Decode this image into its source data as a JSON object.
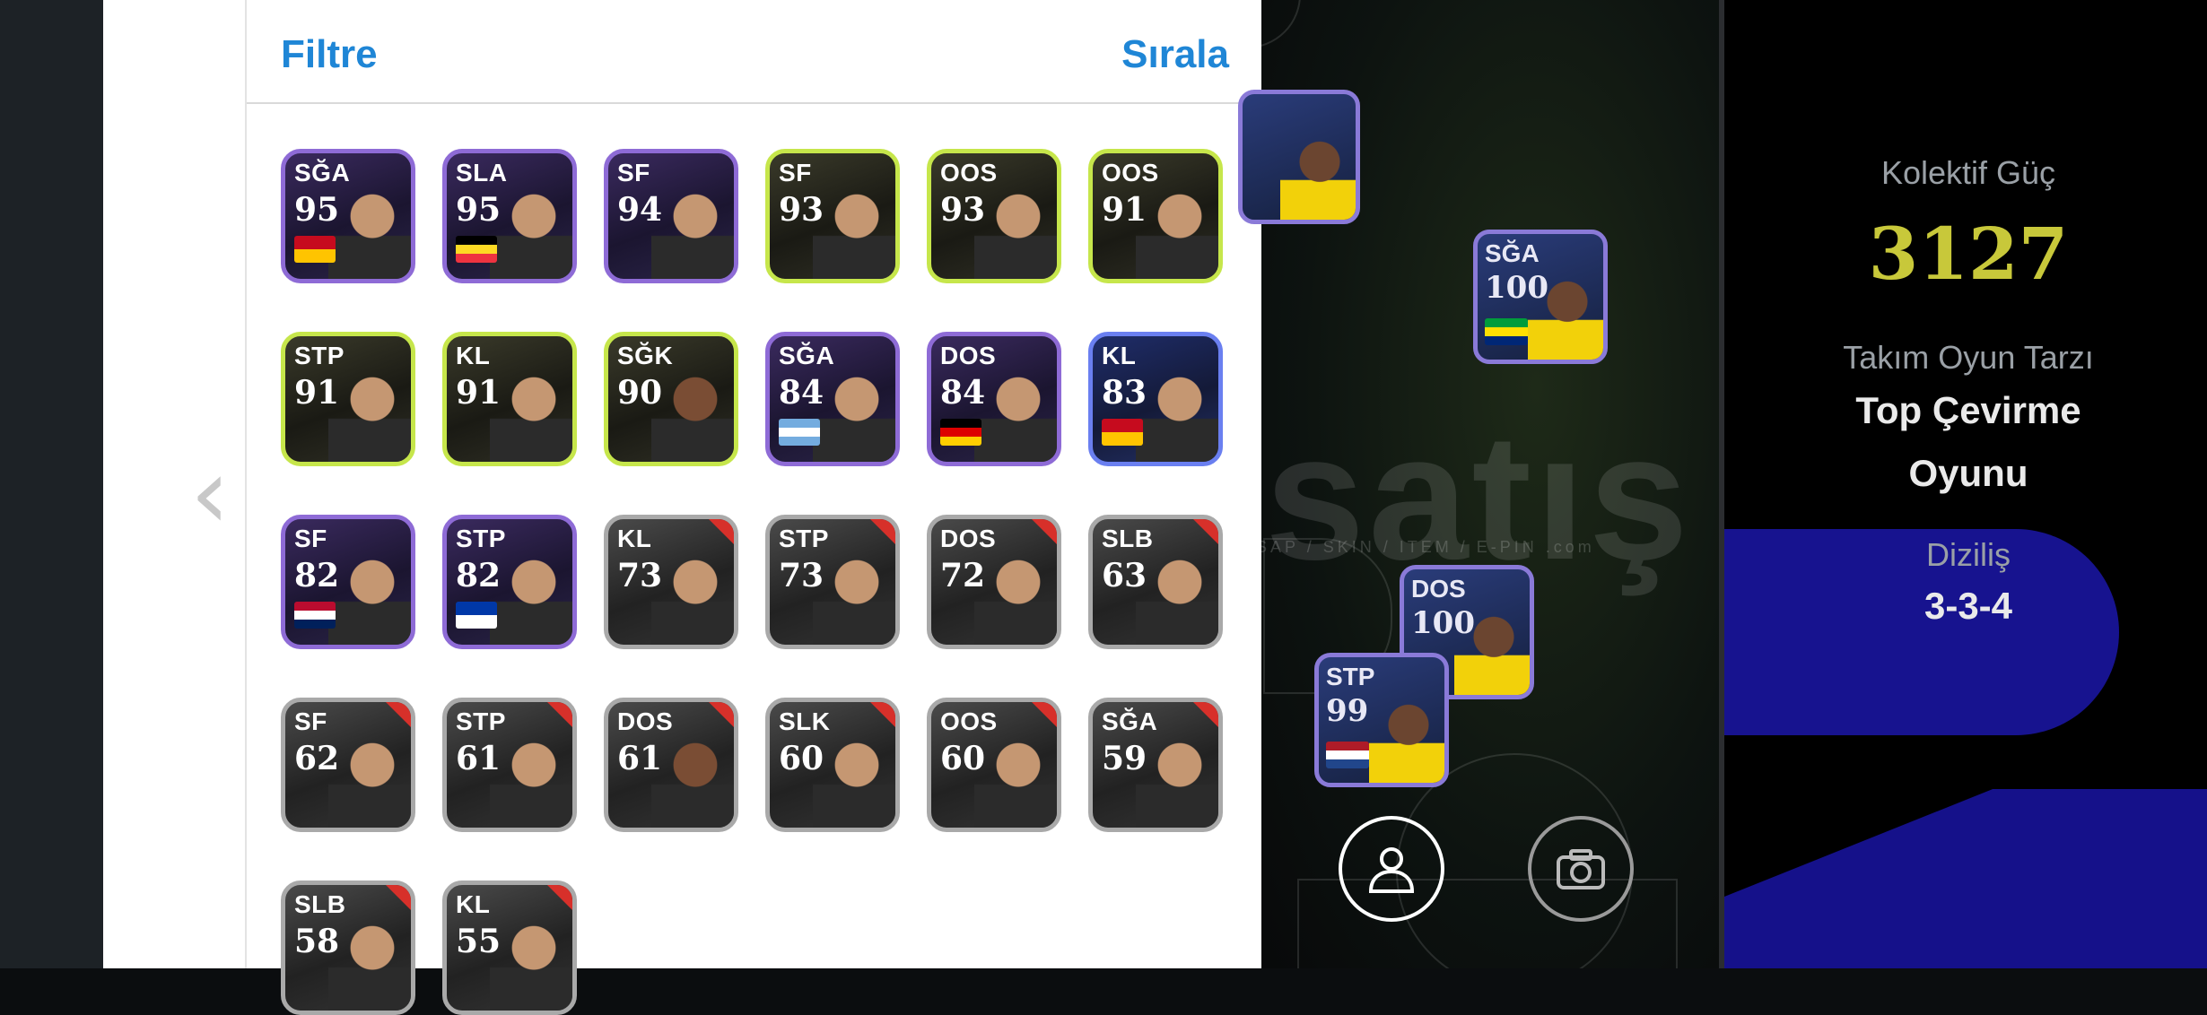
{
  "header": {
    "filter_label": "Filtre",
    "sort_label": "Sırala"
  },
  "back_icon": "chevron-left-icon",
  "players": [
    {
      "pos": "SĞA",
      "rating": "95",
      "flag": [
        "#c60b1e",
        "#ffc400"
      ],
      "style": "b-purple"
    },
    {
      "pos": "SLA",
      "rating": "95",
      "flag": [
        "#000000",
        "#fdda24",
        "#ef3340"
      ],
      "style": "b-purple"
    },
    {
      "pos": "SF",
      "rating": "94",
      "flag": [],
      "style": "b-purple"
    },
    {
      "pos": "SF",
      "rating": "93",
      "flag": [],
      "style": "b-lime"
    },
    {
      "pos": "OOS",
      "rating": "93",
      "flag": [],
      "style": "b-lime"
    },
    {
      "pos": "OOS",
      "rating": "91",
      "flag": [],
      "style": "b-lime"
    },
    {
      "pos": "STP",
      "rating": "91",
      "flag": [],
      "style": "b-lime"
    },
    {
      "pos": "KL",
      "rating": "91",
      "flag": [],
      "style": "b-lime"
    },
    {
      "pos": "SĞK",
      "rating": "90",
      "flag": [],
      "style": "b-lime"
    },
    {
      "pos": "SĞA",
      "rating": "84",
      "flag": [
        "#74acdf",
        "#ffffff",
        "#74acdf"
      ],
      "style": "b-purple"
    },
    {
      "pos": "DOS",
      "rating": "84",
      "flag": [
        "#000000",
        "#dd0000",
        "#ffce00"
      ],
      "style": "b-purple"
    },
    {
      "pos": "KL",
      "rating": "83",
      "flag": [
        "#c60b1e",
        "#ffc400"
      ],
      "style": "b-blue"
    },
    {
      "pos": "SF",
      "rating": "82",
      "flag": [
        "#ba0c2f",
        "#ffffff",
        "#00205b"
      ],
      "style": "b-purple"
    },
    {
      "pos": "STP",
      "rating": "82",
      "flag": [
        "#0038a8",
        "#ffffff"
      ],
      "style": "b-purple"
    },
    {
      "pos": "KL",
      "rating": "73",
      "flag": [],
      "style": "b-grey"
    },
    {
      "pos": "STP",
      "rating": "73",
      "flag": [],
      "style": "b-grey"
    },
    {
      "pos": "DOS",
      "rating": "72",
      "flag": [],
      "style": "b-grey"
    },
    {
      "pos": "SLB",
      "rating": "63",
      "flag": [],
      "style": "b-grey"
    },
    {
      "pos": "SF",
      "rating": "62",
      "flag": [],
      "style": "b-grey"
    },
    {
      "pos": "STP",
      "rating": "61",
      "flag": [],
      "style": "b-grey"
    },
    {
      "pos": "DOS",
      "rating": "61",
      "flag": [],
      "style": "b-grey"
    },
    {
      "pos": "SLK",
      "rating": "60",
      "flag": [],
      "style": "b-grey"
    },
    {
      "pos": "OOS",
      "rating": "60",
      "flag": [],
      "style": "b-grey"
    },
    {
      "pos": "SĞA",
      "rating": "59",
      "flag": [],
      "style": "b-grey"
    },
    {
      "pos": "SLB",
      "rating": "58",
      "flag": [],
      "style": "b-grey"
    },
    {
      "pos": "KL",
      "rating": "55",
      "flag": [],
      "style": "b-grey"
    }
  ],
  "field_players": [
    {
      "pos": "SĞA",
      "rating": "100",
      "flag": [
        "#009c3b",
        "#ffdf00",
        "#002776"
      ]
    },
    {
      "pos": "DOS",
      "rating": "100",
      "flag": []
    },
    {
      "pos": "STP",
      "rating": "99",
      "flag": [
        "#ae1c28",
        "#ffffff",
        "#21468b"
      ]
    }
  ],
  "watermark": {
    "main": "satış",
    "sub": "SAP / SKIN / ITEM / E-PIN .com"
  },
  "info": {
    "power_label": "Kolektif Güç",
    "power_value": "3127",
    "style_label": "Takım Oyun Tarzı",
    "style_line1": "Top Çevirme",
    "style_line2": "Oyunu",
    "formation_label": "Diziliş",
    "formation_value": "3-3-4"
  },
  "buttons": {
    "profile_icon": "person-icon",
    "camera_icon": "camera-icon"
  },
  "colors": {
    "accent": "#1f86d6",
    "power": "#c8c83a",
    "blue_panel": "#17138f"
  }
}
